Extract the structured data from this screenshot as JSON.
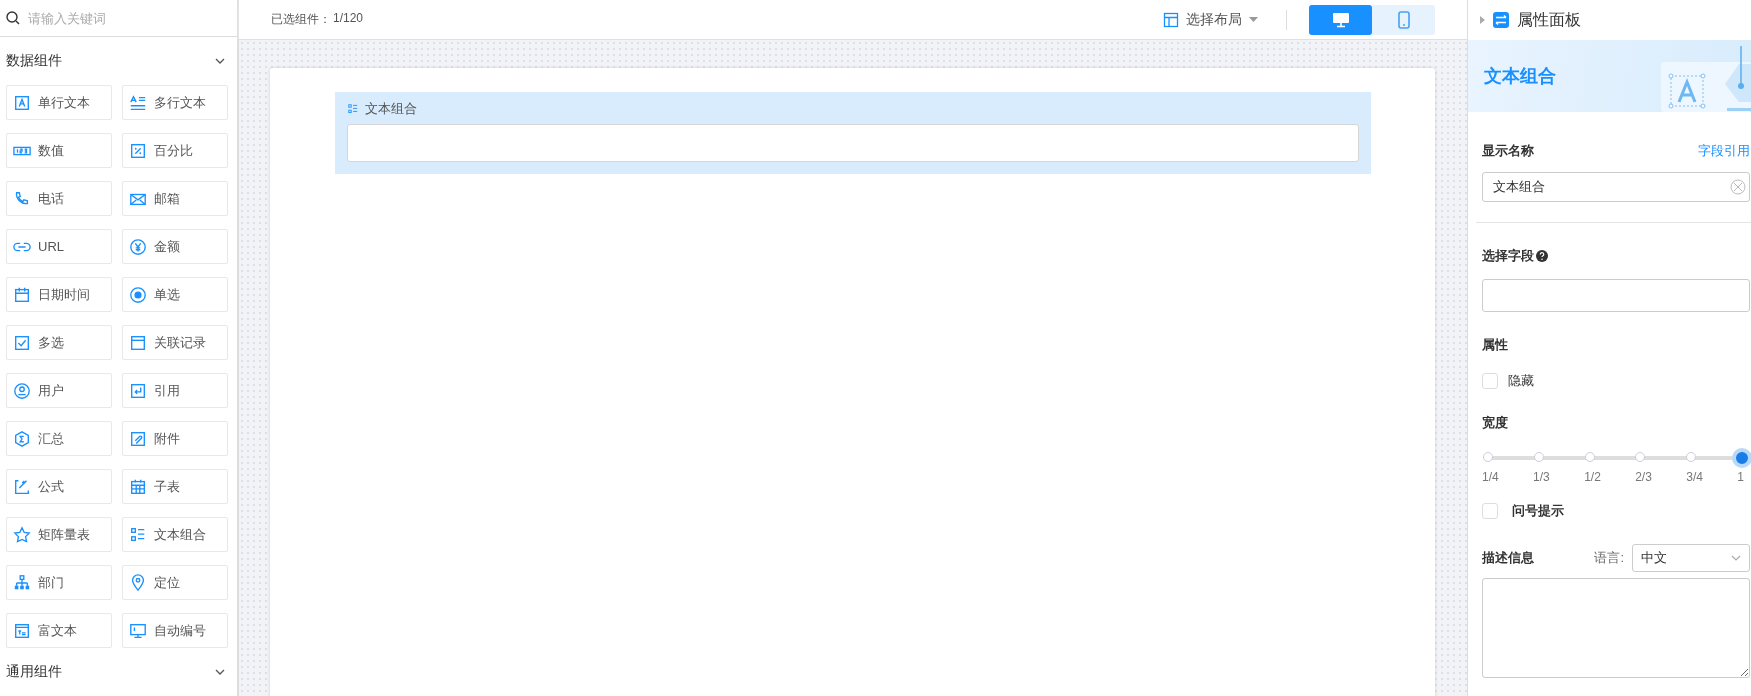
{
  "search": {
    "placeholder": "请输入关键词"
  },
  "component_groups": [
    {
      "title": "数据组件",
      "items": [
        {
          "label": "单行文本"
        },
        {
          "label": "多行文本"
        },
        {
          "label": "数值"
        },
        {
          "label": "百分比"
        },
        {
          "label": "电话"
        },
        {
          "label": "邮箱"
        },
        {
          "label": "URL"
        },
        {
          "label": "金额"
        },
        {
          "label": "日期时间"
        },
        {
          "label": "单选"
        },
        {
          "label": "多选"
        },
        {
          "label": "关联记录"
        },
        {
          "label": "用户"
        },
        {
          "label": "引用"
        },
        {
          "label": "汇总"
        },
        {
          "label": "附件"
        },
        {
          "label": "公式"
        },
        {
          "label": "子表"
        },
        {
          "label": "矩阵量表"
        },
        {
          "label": "文本组合"
        },
        {
          "label": "部门"
        },
        {
          "label": "定位"
        },
        {
          "label": "富文本"
        },
        {
          "label": "自动编号"
        }
      ]
    },
    {
      "title": "通用组件"
    }
  ],
  "toolbar": {
    "selected_count_label": "已选组件：",
    "selected_count": "1/120",
    "layout_button": "选择布局",
    "view_modes": [
      {
        "kind": "desktop",
        "selected": true
      },
      {
        "kind": "mobile",
        "selected": false
      }
    ]
  },
  "canvas": {
    "fields": [
      {
        "label": "文本组合"
      }
    ]
  },
  "properties": {
    "title": "属性面板",
    "component_name": "文本组合",
    "display_name": {
      "label": "显示名称",
      "link": "字段引用",
      "value": "文本组合"
    },
    "field_select": {
      "label": "选择字段"
    },
    "attributes": {
      "label": "属性",
      "options": [
        {
          "label": "隐藏",
          "checked": false
        }
      ]
    },
    "width": {
      "label": "宽度",
      "level": 1,
      "stops": [
        "1/4",
        "1/3",
        "1/2",
        "2/3",
        "3/4",
        "1"
      ]
    },
    "tooltip_option": {
      "label": "问号提示",
      "checked": false
    },
    "description": {
      "label": "描述信息",
      "language_label": "语言:",
      "language": "中文"
    }
  }
}
